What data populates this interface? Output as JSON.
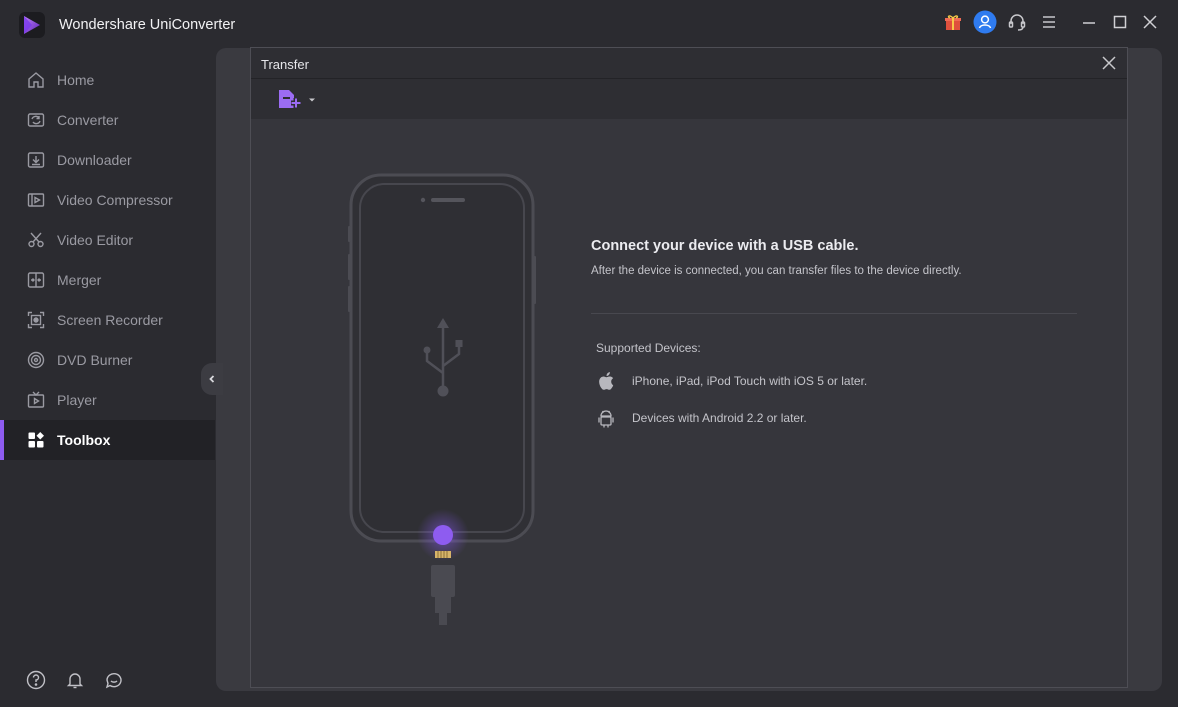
{
  "app": {
    "title": "Wondershare UniConverter",
    "accent_color": "#8e5cf0"
  },
  "titlebar": {
    "icons": [
      "gift-icon",
      "account-icon",
      "headset-icon",
      "menu-icon",
      "minimize-icon",
      "maximize-icon",
      "close-icon"
    ]
  },
  "sidebar": {
    "items": [
      {
        "label": "Home",
        "icon": "home-icon"
      },
      {
        "label": "Converter",
        "icon": "converter-icon"
      },
      {
        "label": "Downloader",
        "icon": "downloader-icon"
      },
      {
        "label": "Video Compressor",
        "icon": "video-compressor-icon"
      },
      {
        "label": "Video Editor",
        "icon": "scissors-icon"
      },
      {
        "label": "Merger",
        "icon": "merger-icon"
      },
      {
        "label": "Screen Recorder",
        "icon": "screen-recorder-icon"
      },
      {
        "label": "DVD Burner",
        "icon": "dvd-icon"
      },
      {
        "label": "Player",
        "icon": "player-icon"
      },
      {
        "label": "Toolbox",
        "icon": "toolbox-icon",
        "active": true
      }
    ],
    "bottom_icons": [
      "help-icon",
      "bell-icon",
      "feedback-icon"
    ]
  },
  "dialog": {
    "title": "Transfer",
    "toolbar": {
      "add_icon": "add-file-icon"
    },
    "connect_title": "Connect your device with a USB cable.",
    "connect_subtitle": "After the device is connected, you can transfer files to the device directly.",
    "supported_title": "Supported Devices:",
    "devices": [
      {
        "icon": "apple-icon",
        "text": "iPhone, iPad, iPod Touch with iOS 5 or later."
      },
      {
        "icon": "android-icon",
        "text": "Devices with Android 2.2 or later."
      }
    ]
  }
}
